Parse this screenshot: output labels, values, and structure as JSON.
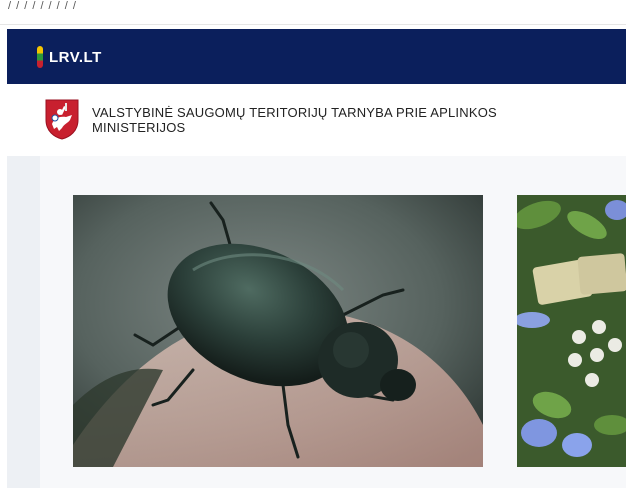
{
  "browser": {
    "url_fragment": "/ / / / / / / / /"
  },
  "brand": {
    "logo_text": "LRV.LT",
    "flag_colors": [
      "#f5c400",
      "#2e9a3a",
      "#c8202f"
    ],
    "navbar_color": "#0b1f5c"
  },
  "organization": {
    "name_line1": "VALSTYBINĖ SAUGOMŲ TERITORIJŲ TARNYBA PRIE APLINKOS",
    "name_line2": "MINISTERIJOS",
    "emblem": "vytis-coat-of-arms-icon"
  },
  "gallery": {
    "items": [
      {
        "image": "beetle-on-hand-photo"
      },
      {
        "image": "plants-and-flowers-photo"
      }
    ]
  }
}
